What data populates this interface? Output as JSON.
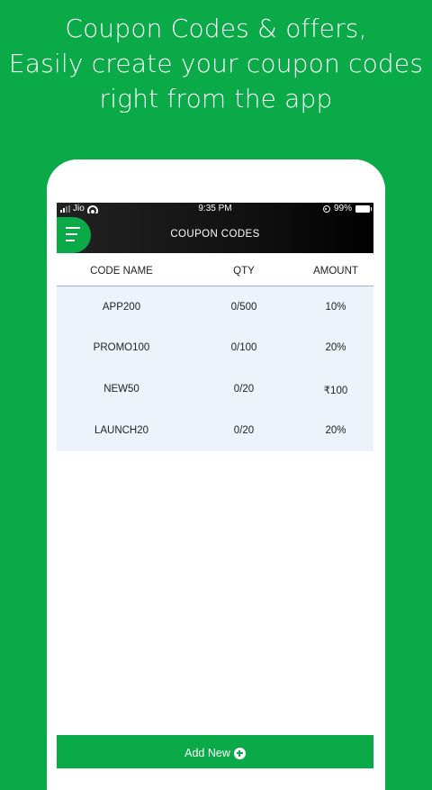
{
  "promo": {
    "line1": "Coupon Codes & offers,",
    "line2": "Easily create your coupon codes",
    "line3": "right from the app"
  },
  "status_bar": {
    "carrier": "Jio",
    "time": "9:35 PM",
    "battery": "99%"
  },
  "header": {
    "title": "COUPON CODES"
  },
  "table": {
    "columns": [
      "CODE NAME",
      "QTY",
      "AMOUNT"
    ],
    "rows": [
      {
        "code": "APP200",
        "qty": "0/500",
        "amount": "10%"
      },
      {
        "code": "PROMO100",
        "qty": "0/100",
        "amount": "20%"
      },
      {
        "code": "NEW50",
        "qty": "0/20",
        "amount": "₹100"
      },
      {
        "code": "LAUNCH20",
        "qty": "0/20",
        "amount": "20%"
      }
    ]
  },
  "footer": {
    "add_label": "Add New"
  },
  "colors": {
    "brand_green": "#0aaa48",
    "row_background": "#eef3fb",
    "header_divider": "#8fb2d8"
  }
}
